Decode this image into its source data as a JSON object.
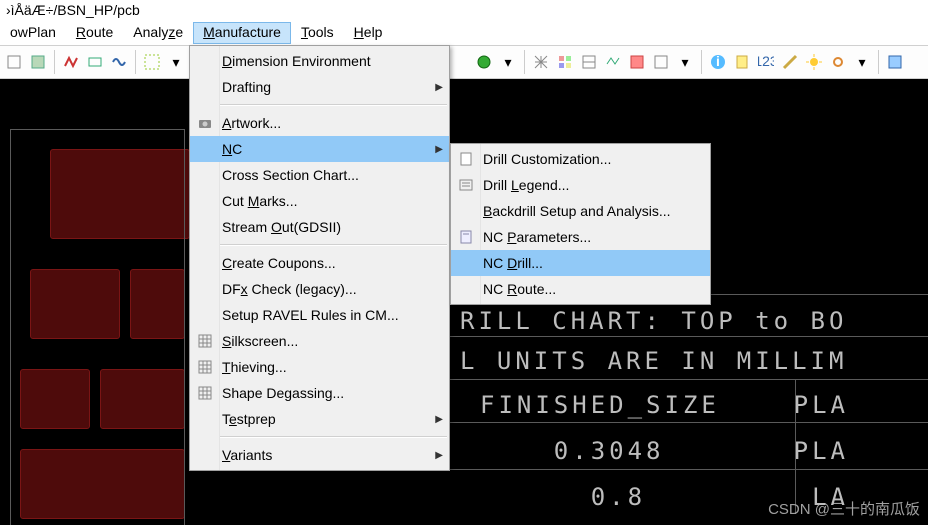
{
  "title": "›ìÅäÆ÷/BSN_HP/pcb",
  "menubar": {
    "owplan": "owPlan",
    "route": "Route",
    "analyze": "Analyze",
    "manufacture": "Manufacture",
    "tools": "Tools",
    "help": "Help"
  },
  "dropdown1": {
    "items": [
      {
        "label": "Dimension Environment",
        "ul": "D"
      },
      {
        "label": "Drafting",
        "ul": "",
        "arrow": true
      },
      {
        "sep": true
      },
      {
        "label": "Artwork...",
        "ul": "A",
        "ic": "camera"
      },
      {
        "label": "NC",
        "ul": "N",
        "arrow": true,
        "hi": true
      },
      {
        "label": "Cross Section Chart...",
        "ul": ""
      },
      {
        "label": "Cut Marks...",
        "ul": "M"
      },
      {
        "label": "Stream Out(GDSII)",
        "ul": "O"
      },
      {
        "sep": true
      },
      {
        "label": "Create Coupons...",
        "ul": "C"
      },
      {
        "label": "DFx Check (legacy)...",
        "ul": "x"
      },
      {
        "label": "Setup RAVEL Rules in CM...",
        "ul": ""
      },
      {
        "label": "Silkscreen...",
        "ul": "S",
        "ic": "grid"
      },
      {
        "label": "Thieving...",
        "ul": "T",
        "ic": "grid"
      },
      {
        "label": "Shape Degassing...",
        "ul": "",
        "ic": "grid"
      },
      {
        "label": "Testprep",
        "ul": "e",
        "arrow": true
      },
      {
        "sep": true
      },
      {
        "label": "Variants",
        "ul": "V",
        "arrow": true
      }
    ]
  },
  "dropdown2": {
    "items": [
      {
        "label": "Drill Customization...",
        "ul": "",
        "ic": "page"
      },
      {
        "label": "Drill Legend...",
        "ul": "L",
        "ic": "legend"
      },
      {
        "label": "Backdrill Setup and Analysis...",
        "ul": "B"
      },
      {
        "label": "NC Parameters...",
        "ul": "P",
        "ic": "param"
      },
      {
        "label": "NC Drill...",
        "ul": "D",
        "hi": true
      },
      {
        "label": "NC Route...",
        "ul": "R"
      }
    ]
  },
  "table_lines": [
    "RILL CHART: TOP to BO",
    "L UNITS ARE IN MILLIM",
    "FINISHED_SIZE    PLA",
    "    0.3048       PLA",
    "      0.8         LA"
  ],
  "watermark": "CSDN @三十的南瓜饭"
}
